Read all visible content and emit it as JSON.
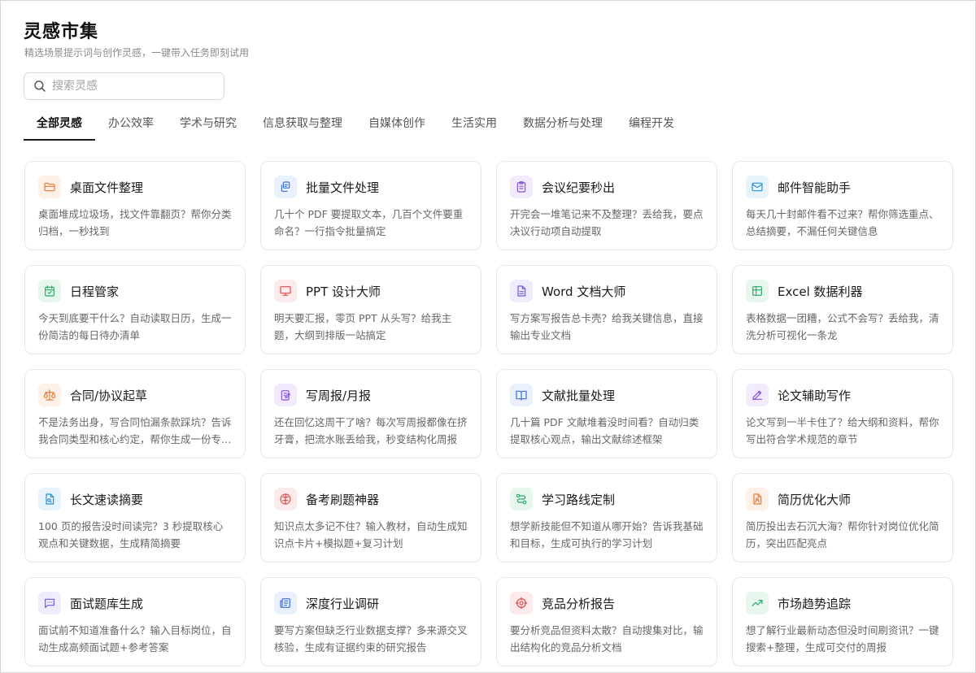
{
  "header": {
    "title": "灵感市集",
    "subtitle": "精选场景提示词与创作灵感，一键带入任务即刻试用"
  },
  "search": {
    "placeholder": "搜索灵感"
  },
  "tabs": [
    "全部灵感",
    "办公效率",
    "学术与研究",
    "信息获取与整理",
    "自媒体创作",
    "生活实用",
    "数据分析与处理",
    "编程开发"
  ],
  "active_tab": "全部灵感",
  "cards": [
    {
      "title": "桌面文件整理",
      "desc": "桌面堆成垃圾场，找文件靠翻页？帮你分类归档，一秒找到",
      "icon": "folder-icon",
      "color": "#e8793a",
      "bg": "#fdf0e7"
    },
    {
      "title": "批量文件处理",
      "desc": "几十个 PDF 要提取文本，几百个文件要重命名？一行指令批量搞定",
      "icon": "files-icon",
      "color": "#3b6fe0",
      "bg": "#eaf0fd"
    },
    {
      "title": "会议纪要秒出",
      "desc": "开完会一堆笔记来不及整理？丢给我，要点决议行动项自动提取",
      "icon": "clipboard-icon",
      "color": "#8a4fe0",
      "bg": "#f2ebfd"
    },
    {
      "title": "邮件智能助手",
      "desc": "每天几十封邮件看不过来？帮你筛选重点、总结摘要，不漏任何关键信息",
      "icon": "mail-icon",
      "color": "#2a8fd6",
      "bg": "#e7f4fc"
    },
    {
      "title": "日程管家",
      "desc": "今天到底要干什么？自动读取日历，生成一份简洁的每日待办清单",
      "icon": "calendar-icon",
      "color": "#2aa86a",
      "bg": "#e7f7ee"
    },
    {
      "title": "PPT 设计大师",
      "desc": "明天要汇报，零页 PPT 从头写？给我主题，大纲到排版一站搞定",
      "icon": "presentation-icon",
      "color": "#e04a4a",
      "bg": "#fdeaea"
    },
    {
      "title": "Word 文档大师",
      "desc": "写方案写报告总卡壳？给我关键信息，直接输出专业文档",
      "icon": "document-icon",
      "color": "#6f5be0",
      "bg": "#efecfd"
    },
    {
      "title": "Excel 数据利器",
      "desc": "表格数据一团糟，公式不会写？丢给我，清洗分析可视化一条龙",
      "icon": "table-icon",
      "color": "#2aa86a",
      "bg": "#e7f7ee"
    },
    {
      "title": "合同/协议起草",
      "desc": "不是法务出身，写合同怕漏条款踩坑？告诉我合同类型和核心约定，帮你生成一份专业合同",
      "icon": "scale-icon",
      "color": "#e8793a",
      "bg": "#fdf0e7"
    },
    {
      "title": "写周报/月报",
      "desc": "还在回忆这周干了啥？每次写周报都像在挤牙膏，把流水账丢给我，秒变结构化周报",
      "icon": "edit-note-icon",
      "color": "#8a4fe0",
      "bg": "#f2ebfd"
    },
    {
      "title": "文献批量处理",
      "desc": "几十篇 PDF 文献堆着没时间看？自动归类提取核心观点，输出文献综述框架",
      "icon": "book-icon",
      "color": "#3b6fe0",
      "bg": "#eaf0fd"
    },
    {
      "title": "论文辅助写作",
      "desc": "论文写到一半卡住了？给大纲和资料，帮你写出符合学术规范的章节",
      "icon": "pen-icon",
      "color": "#8a4fe0",
      "bg": "#f2ebfd"
    },
    {
      "title": "长文速读摘要",
      "desc": "100 页的报告没时间读完？3 秒提取核心观点和关键数据，生成精简摘要",
      "icon": "file-text-icon",
      "color": "#2a8fd6",
      "bg": "#e7f4fc"
    },
    {
      "title": "备考刷题神器",
      "desc": "知识点太多记不住？输入教材，自动生成知识点卡片+模拟题+复习计划",
      "icon": "brain-icon",
      "color": "#e04a4a",
      "bg": "#fdeaea"
    },
    {
      "title": "学习路线定制",
      "desc": "想学新技能但不知道从哪开始？告诉我基础和目标，生成可执行的学习计划",
      "icon": "route-icon",
      "color": "#2aa86a",
      "bg": "#e7f7ee"
    },
    {
      "title": "简历优化大师",
      "desc": "简历投出去石沉大海？帮你针对岗位优化简历，突出匹配亮点",
      "icon": "resume-icon",
      "color": "#e8793a",
      "bg": "#fdf0e7"
    },
    {
      "title": "面试题库生成",
      "desc": "面试前不知道准备什么？输入目标岗位，自动生成高频面试题+参考答案",
      "icon": "message-icon",
      "color": "#6f5be0",
      "bg": "#efecfd"
    },
    {
      "title": "深度行业调研",
      "desc": "要写方案但缺乏行业数据支撑？多来源交叉核验，生成有证据约束的研究报告",
      "icon": "newspaper-icon",
      "color": "#3b6fe0",
      "bg": "#eaf0fd"
    },
    {
      "title": "竞品分析报告",
      "desc": "要分析竞品但资料太散？自动搜集对比，输出结构化的竞品分析文档",
      "icon": "crosshair-icon",
      "color": "#e04a4a",
      "bg": "#fdeaea"
    },
    {
      "title": "市场趋势追踪",
      "desc": "想了解行业最新动态但没时间刷资讯？一键搜索+整理，生成可交付的周报",
      "icon": "trend-icon",
      "color": "#2aa86a",
      "bg": "#e7f7ee"
    }
  ]
}
